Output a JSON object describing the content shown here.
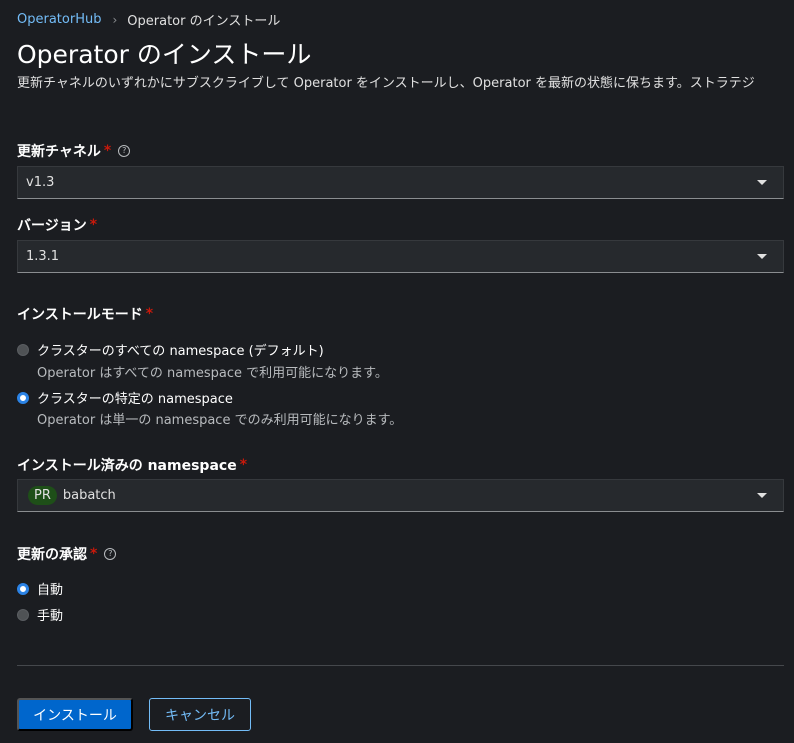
{
  "breadcrumb": {
    "parent": "OperatorHub",
    "current": "Operator のインストール"
  },
  "page": {
    "title": "Operator のインストール",
    "description": "更新チャネルのいずれかにサブスクライブして Operator をインストールし、Operator を最新の状態に保ちます。ストラテジ"
  },
  "update_channel": {
    "label": "更新チャネル",
    "required_mark": "*",
    "value": "v1.3"
  },
  "version": {
    "label": "バージョン",
    "required_mark": "*",
    "value": "1.3.1"
  },
  "install_mode": {
    "label": "インストールモード",
    "required_mark": "*",
    "options": [
      {
        "label": "クラスターのすべての namespace (デフォルト)",
        "description": "Operator はすべての namespace で利用可能になります。",
        "checked": false
      },
      {
        "label": "クラスターの特定の namespace",
        "description": "Operator は単一の namespace でのみ利用可能になります。",
        "checked": true
      }
    ]
  },
  "installed_namespace": {
    "label": "インストール済みの namespace",
    "required_mark": "*",
    "badge": "PR",
    "value": "babatch"
  },
  "update_approval": {
    "label": "更新の承認",
    "required_mark": "*",
    "options": [
      {
        "label": "自動",
        "checked": true
      },
      {
        "label": "手動",
        "checked": false
      }
    ]
  },
  "actions": {
    "install_label": "インストール",
    "cancel_label": "キャンセル"
  },
  "colors": {
    "accent": "#0066cc",
    "link": "#73bcf7",
    "required": "#c9190b",
    "background": "#1b1d21"
  },
  "icons": {
    "breadcrumb_separator": "chevron-right-icon",
    "help": "help-icon",
    "select_toggle": "caret-down-icon"
  }
}
